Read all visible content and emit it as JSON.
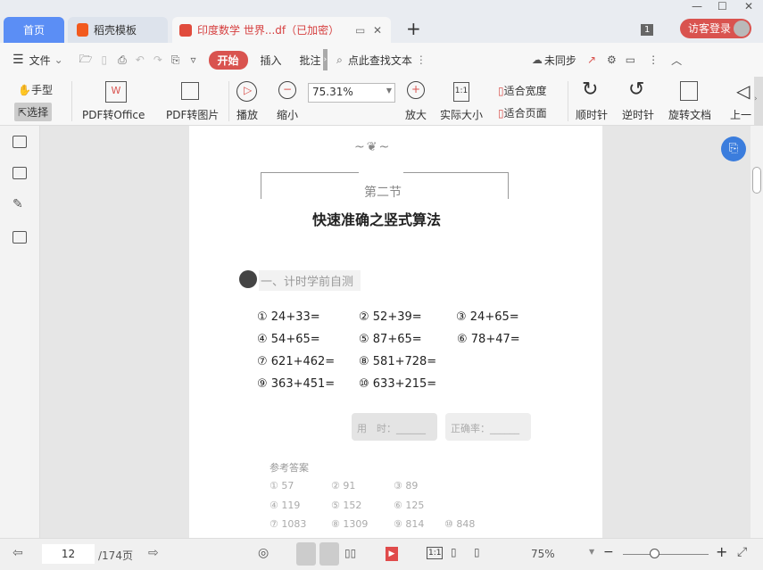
{
  "window": {
    "controls": [
      "—",
      "☐",
      "✕"
    ]
  },
  "tabs": [
    {
      "label": "首页"
    },
    {
      "label": "稻壳模板"
    },
    {
      "label": "印度数学 世界...df（已加密）"
    }
  ],
  "new_tab": "+",
  "badge_count": "1",
  "login_label": "访客登录",
  "toolbar": {
    "menu": "文件",
    "tabs": [
      "开始",
      "插入",
      "批注"
    ],
    "search": "点此查找文本",
    "sync": "未同步"
  },
  "ribbon": {
    "hand": "手型",
    "select": "选择",
    "pdf_office": "PDF转Office",
    "pdf_image": "PDF转图片",
    "play": "播放",
    "zoom_out": "缩小",
    "zoom_value": "75.31%",
    "zoom_in": "放大",
    "actual_size": "实际大小",
    "fit_width": "适合宽度",
    "fit_page": "适合页面",
    "clockwise": "顺时针",
    "counter": "逆时针",
    "rotate": "旋转文档",
    "prev": "上一"
  },
  "document": {
    "section": "第二节",
    "title": "快速准确之竖式算法",
    "subheading": "一、计时学前自测",
    "questions": [
      "① 24+33=",
      "② 52+39=",
      "③ 24+65=",
      "④ 54+65=",
      "⑤ 87+65=",
      "⑥ 78+47=",
      "⑦ 621+462=",
      "⑧ 581+728=",
      "⑨ 363+451=",
      "⑩ 633+215="
    ],
    "time_label": "用　时：______",
    "accuracy_label": "正确率：______",
    "answers_title": "参考答案",
    "answers": [
      "① 57",
      "② 91",
      "③ 89",
      "④ 119",
      "⑤ 152",
      "⑥ 125",
      "⑦ 1083",
      "⑧ 1309",
      "⑨ 814",
      "⑩ 848"
    ]
  },
  "status": {
    "page": "12",
    "total": "/174页",
    "zoom": "75%",
    "one_to_one": "1:1"
  }
}
